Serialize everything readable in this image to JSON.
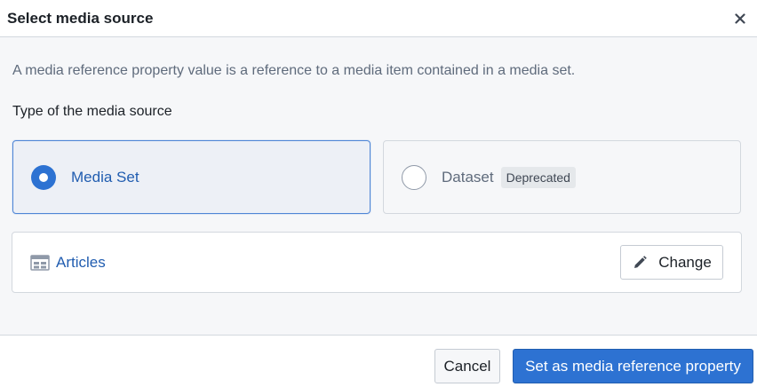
{
  "dialog": {
    "title": "Select media source",
    "close_icon": "close-icon"
  },
  "body": {
    "description": "A media reference property value is a reference to a media item contained in a media set.",
    "section_label": "Type of the media source",
    "options": [
      {
        "label": "Media Set",
        "selected": true
      },
      {
        "label": "Dataset",
        "selected": false,
        "tag": "Deprecated"
      }
    ],
    "resource": {
      "icon": "table-icon",
      "name": "Articles",
      "change_label": "Change",
      "change_icon": "pencil-icon"
    }
  },
  "footer": {
    "cancel_label": "Cancel",
    "primary_label": "Set as media reference property"
  },
  "colors": {
    "primary": "#2d72d2",
    "link": "#215db0",
    "selected_card_bg": "#edf0f6",
    "selected_card_border": "#4f86d6"
  }
}
